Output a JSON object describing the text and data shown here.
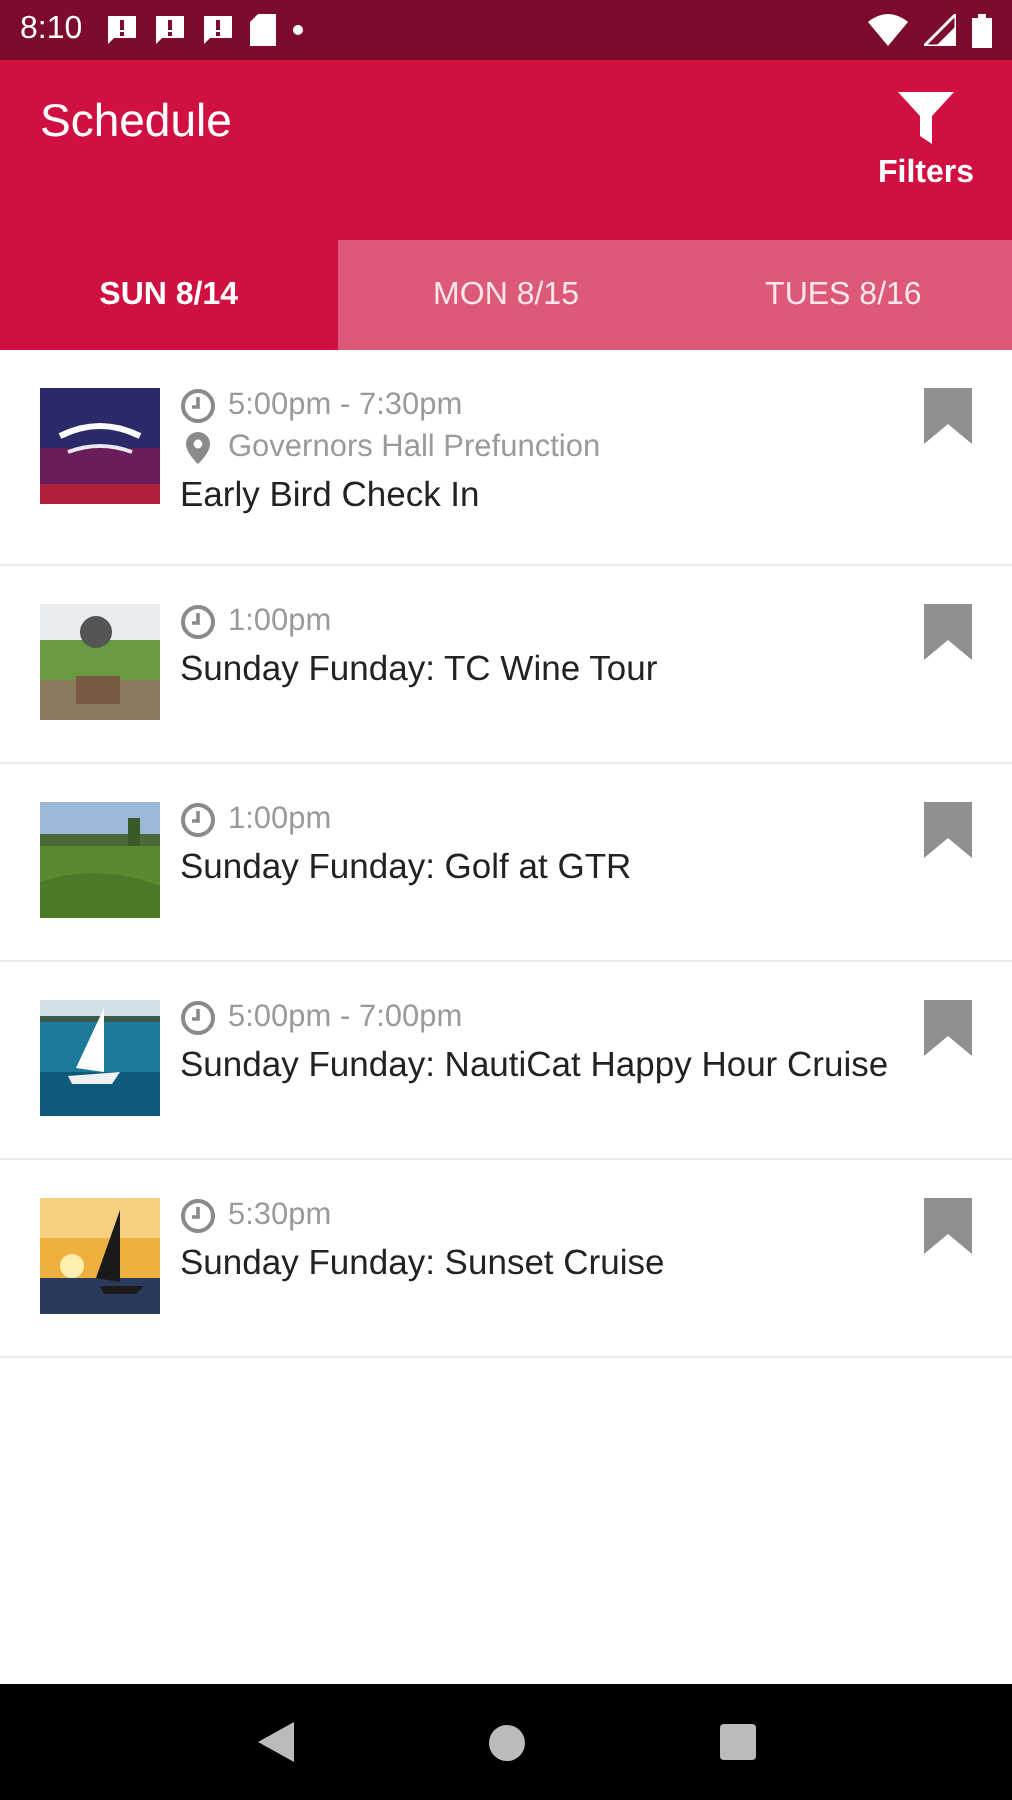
{
  "status_bar": {
    "time": "8:10"
  },
  "app_bar": {
    "title": "Schedule",
    "filter_label": "Filters"
  },
  "tabs": [
    {
      "label": "SUN 8/14",
      "selected": true
    },
    {
      "label": "MON 8/15",
      "selected": false
    },
    {
      "label": "TUES 8/16",
      "selected": false
    }
  ],
  "events": [
    {
      "time": "5:00pm - 7:30pm",
      "location": "Governors Hall Prefunction",
      "title": "Early Bird Check In",
      "bookmarked": false
    },
    {
      "time": "1:00pm",
      "title": "Sunday Funday: TC Wine Tour",
      "bookmarked": false
    },
    {
      "time": "1:00pm",
      "title": "Sunday Funday: Golf at GTR",
      "bookmarked": false
    },
    {
      "time": "5:00pm - 7:00pm",
      "title": "Sunday Funday: NautiCat Happy Hour Cruise",
      "bookmarked": false
    },
    {
      "time": "5:30pm",
      "title": "Sunday Funday: Sunset Cruise",
      "bookmarked": false
    }
  ]
}
